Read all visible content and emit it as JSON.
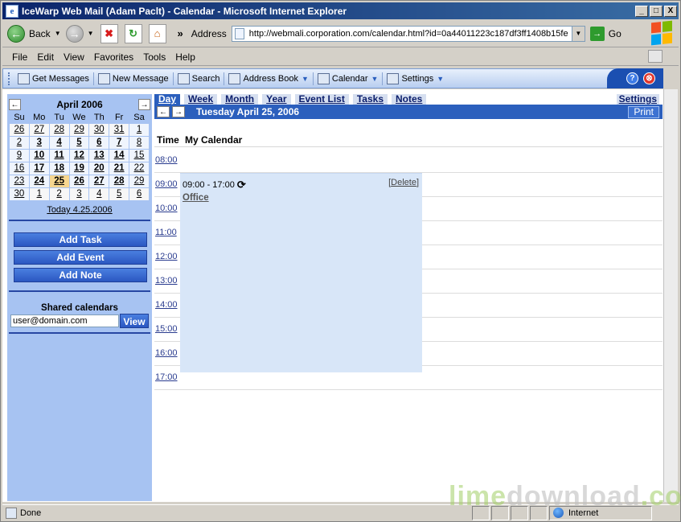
{
  "window": {
    "title": "IceWarp Web Mail (Adam Paclt) - Calendar - Microsoft Internet Explorer",
    "buttons": {
      "minimize": "_",
      "maximize": "□",
      "close": "X"
    }
  },
  "ie_toolbar": {
    "back_label": "Back",
    "address_label": "Address",
    "url": "http://webmali.corporation.com/calendar.html?id=0a44011223c187df3ff1408b15fe",
    "go_label": "Go"
  },
  "menu": [
    "File",
    "Edit",
    "View",
    "Favorites",
    "Tools",
    "Help"
  ],
  "app_toolbar": {
    "items": [
      {
        "label": "Get Messages",
        "icon": "get-messages-icon"
      },
      {
        "label": "New Message",
        "icon": "new-message-icon"
      },
      {
        "label": "Search",
        "icon": "search-icon"
      },
      {
        "label": "Address Book",
        "icon": "address-book-icon"
      },
      {
        "label": "Calendar",
        "icon": "calendar-icon"
      },
      {
        "label": "Settings",
        "icon": "settings-icon"
      }
    ],
    "help_glyph": "?",
    "close_glyph": "⊗"
  },
  "mini_calendar": {
    "title": "April 2006",
    "prev": "←",
    "next": "→",
    "weekdays": [
      "Su",
      "Mo",
      "Tu",
      "We",
      "Th",
      "Fr",
      "Sa"
    ],
    "weeks": [
      [
        "26",
        "27",
        "28",
        "29",
        "30",
        "31",
        "1"
      ],
      [
        "2",
        "3",
        "4",
        "5",
        "6",
        "7",
        "8"
      ],
      [
        "9",
        "10",
        "11",
        "12",
        "13",
        "14",
        "15"
      ],
      [
        "16",
        "17",
        "18",
        "19",
        "20",
        "21",
        "22"
      ],
      [
        "23",
        "24",
        "25",
        "26",
        "27",
        "28",
        "29"
      ],
      [
        "30",
        "1",
        "2",
        "3",
        "4",
        "5",
        "6"
      ]
    ],
    "today_link": "Today 4.25.2006"
  },
  "sidebar": {
    "add_task": "Add Task",
    "add_event": "Add Event",
    "add_note": "Add Note",
    "shared_title": "Shared calendars",
    "shared_value": "user@domain.com",
    "view_label": "View"
  },
  "calendar": {
    "tabs": [
      "Day",
      "Week",
      "Month",
      "Year",
      "Event List",
      "Tasks",
      "Notes"
    ],
    "settings_tab": "Settings",
    "date_title": "Tuesday April 25, 2006",
    "print_label": "Print",
    "col_time": "Time",
    "col_calendar": "My Calendar",
    "hours": [
      "08:00",
      "09:00",
      "10:00",
      "11:00",
      "12:00",
      "13:00",
      "14:00",
      "15:00",
      "16:00",
      "17:00"
    ],
    "event": {
      "time": "09:00 - 17:00",
      "delete": "Delete",
      "title": "Office"
    }
  },
  "statusbar": {
    "text": "Done",
    "zone": "Internet"
  },
  "watermark": {
    "part1": "lime",
    "part2": "download",
    "part3": ".com"
  }
}
